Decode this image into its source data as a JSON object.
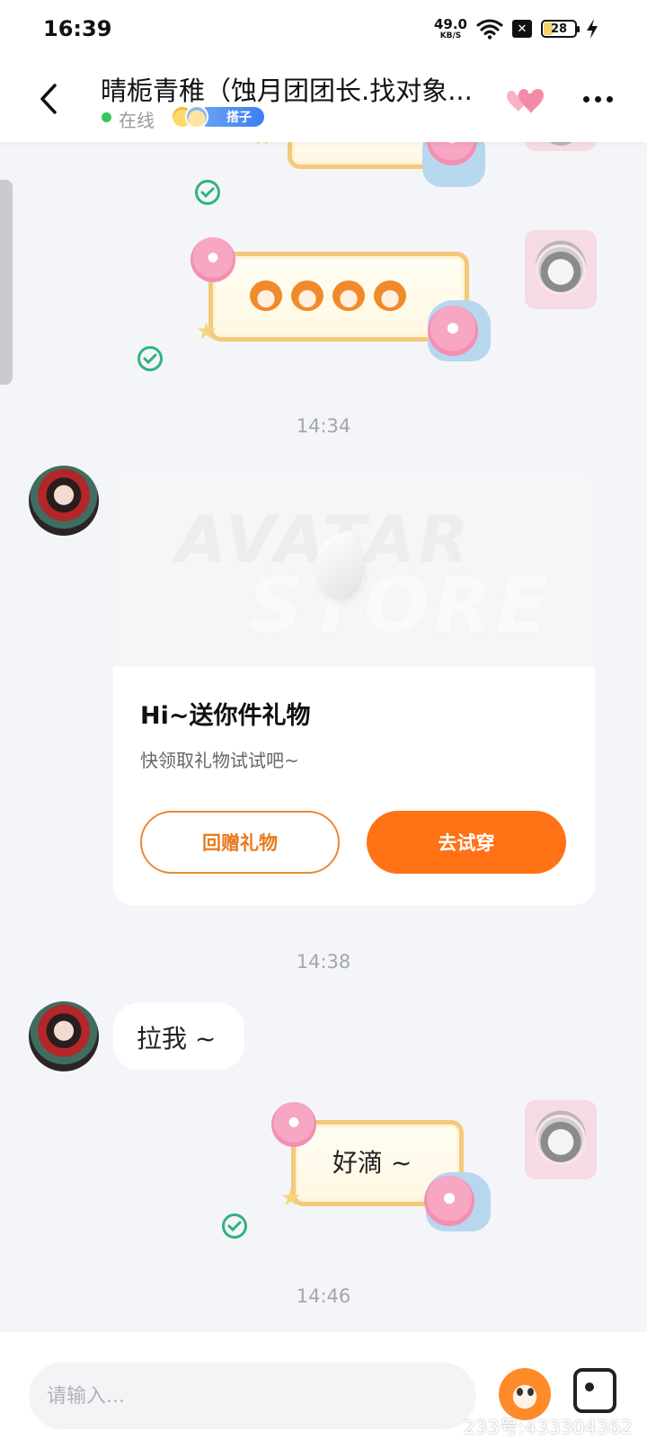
{
  "status_bar": {
    "time": "16:39",
    "net_speed_value": "49.0",
    "net_speed_unit": "KB/S",
    "battery": "28",
    "battery_level": 0.28,
    "icons": [
      "wifi-icon",
      "sim-disabled-icon",
      "battery-icon",
      "charging-icon"
    ]
  },
  "header": {
    "back_icon": "chevron-left-icon",
    "contact_name": "晴栀青稚（蚀月团团长.找对象...",
    "online_status": "在线",
    "partner_badge": "搭子",
    "hearts_icon": "hearts-icon",
    "more_icon": "more-dots-icon"
  },
  "chat": {
    "timestamps": [
      "14:34",
      "14:38",
      "14:46"
    ],
    "gift_card": {
      "banner_watermark_line1": "AVATAR",
      "banner_watermark_line2": "STORE",
      "title": "Hi~送你件礼物",
      "subtitle": "快领取礼物试试吧~",
      "return_button": "回赠礼物",
      "try_button": "去试穿"
    },
    "incoming_text": "拉我 ~",
    "outgoing_text": "好滴 ~"
  },
  "input_bar": {
    "placeholder": "请输入...",
    "mascot_icon": "mascot-emoji-icon",
    "photo_icon": "image-icon",
    "watermark": "233号:433304362"
  },
  "colors": {
    "accent": "#ff7216",
    "online": "#35c759",
    "read_check": "#2fb37f",
    "background": "#f4f5f9"
  }
}
